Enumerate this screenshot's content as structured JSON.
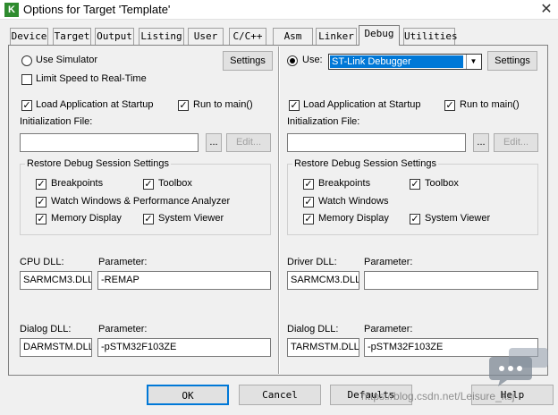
{
  "window": {
    "title": "Options for Target 'Template'",
    "icon": "keil-icon",
    "close": "✕"
  },
  "tabs": [
    {
      "label": "Device"
    },
    {
      "label": "Target"
    },
    {
      "label": "Output"
    },
    {
      "label": "Listing"
    },
    {
      "label": "User"
    },
    {
      "label": "C/C++"
    },
    {
      "label": "Asm"
    },
    {
      "label": "Linker"
    },
    {
      "label": "Debug"
    },
    {
      "label": "Utilities"
    }
  ],
  "active_tab": "Debug",
  "left": {
    "use_simulator": "Use Simulator",
    "settings": "Settings",
    "limit_speed": "Limit Speed to Real-Time",
    "load_app": "Load Application at Startup",
    "run_to_main": "Run to main()",
    "init_file": "Initialization File:",
    "browse": "...",
    "edit": "Edit...",
    "restore_group": "Restore Debug Session Settings",
    "breakpoints": "Breakpoints",
    "toolbox": "Toolbox",
    "watch": "Watch Windows & Performance Analyzer",
    "memory": "Memory Display",
    "system_viewer": "System Viewer",
    "cpu_dll_label": "CPU DLL:",
    "param_label": "Parameter:",
    "cpu_dll": "SARMCM3.DLL",
    "cpu_param": "-REMAP",
    "dialog_dll_label": "Dialog DLL:",
    "param_label2": "Parameter:",
    "dialog_dll": "DARMSTM.DLL",
    "dialog_param": "-pSTM32F103ZE"
  },
  "right": {
    "use": "Use:",
    "debugger": "ST-Link Debugger",
    "settings": "Settings",
    "load_app": "Load Application at Startup",
    "run_to_main": "Run to main()",
    "init_file": "Initialization File:",
    "browse": "...",
    "edit": "Edit...",
    "restore_group": "Restore Debug Session Settings",
    "breakpoints": "Breakpoints",
    "toolbox": "Toolbox",
    "watch": "Watch Windows",
    "memory": "Memory Display",
    "system_viewer": "System Viewer",
    "driver_dll_label": "Driver DLL:",
    "param_label": "Parameter:",
    "driver_dll": "SARMCM3.DLL",
    "driver_param": "",
    "dialog_dll_label": "Dialog DLL:",
    "param_label2": "Parameter:",
    "dialog_dll": "TARMSTM.DLL",
    "dialog_param": "-pSTM32F103ZE"
  },
  "checks": {
    "mark": "✓"
  },
  "footer": {
    "ok": "OK",
    "cancel": "Cancel",
    "defaults": "Defaults",
    "help": "Help"
  },
  "watermark": "https://blog.csdn.net/Leisure_ksj"
}
